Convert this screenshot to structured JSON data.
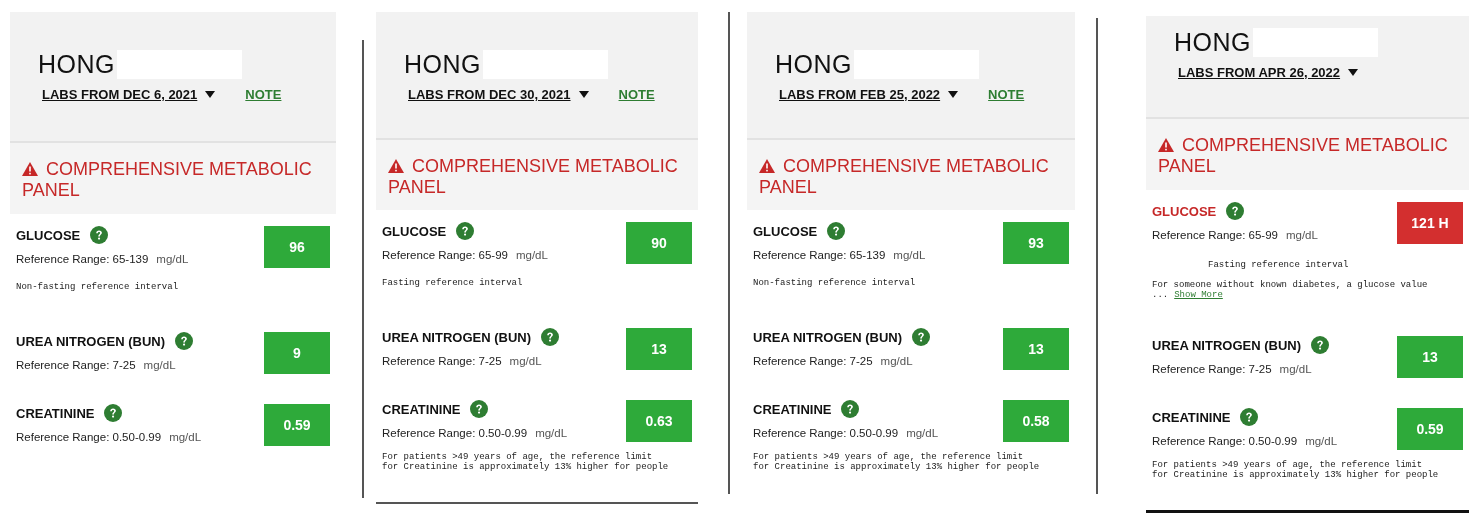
{
  "panels": [
    {
      "patient": "HONG",
      "labs_date": "LABS FROM DEC 6, 2021",
      "note": "NOTE",
      "section": {
        "title": "COMPREHENSIVE METABOLIC PANEL",
        "alert": true
      },
      "tests": [
        {
          "name": "GLUCOSE",
          "range": "Reference Range: 65-139",
          "unit": "mg/dL",
          "value": "96",
          "high": false,
          "interval": "Non-fasting reference interval"
        },
        {
          "name": "UREA NITROGEN (BUN)",
          "range": "Reference Range: 7-25",
          "unit": "mg/dL",
          "value": "9",
          "high": false
        },
        {
          "name": "CREATININE",
          "range": "Reference Range: 0.50-0.99",
          "unit": "mg/dL",
          "value": "0.59",
          "high": false
        }
      ]
    },
    {
      "patient": "HONG",
      "labs_date": "LABS FROM DEC 30, 2021",
      "note": "NOTE",
      "section": {
        "title": "COMPREHENSIVE METABOLIC PANEL",
        "alert": true
      },
      "tests": [
        {
          "name": "GLUCOSE",
          "range": "Reference Range: 65-99",
          "unit": "mg/dL",
          "value": "90",
          "high": false,
          "interval": "Fasting reference interval"
        },
        {
          "name": "UREA NITROGEN (BUN)",
          "range": "Reference Range: 7-25",
          "unit": "mg/dL",
          "value": "13",
          "high": false
        },
        {
          "name": "CREATININE",
          "range": "Reference Range: 0.50-0.99",
          "unit": "mg/dL",
          "value": "0.63",
          "high": false,
          "detail": "For patients >49 years of age, the reference limit\nfor Creatinine is approximately 13% higher for people"
        }
      ]
    },
    {
      "patient": "HONG",
      "labs_date": "LABS FROM FEB 25, 2022",
      "note": "NOTE",
      "section": {
        "title": "COMPREHENSIVE METABOLIC PANEL",
        "alert": true
      },
      "tests": [
        {
          "name": "GLUCOSE",
          "range": "Reference Range: 65-139",
          "unit": "mg/dL",
          "value": "93",
          "high": false,
          "interval": "Non-fasting reference interval"
        },
        {
          "name": "UREA NITROGEN (BUN)",
          "range": "Reference Range: 7-25",
          "unit": "mg/dL",
          "value": "13",
          "high": false
        },
        {
          "name": "CREATININE",
          "range": "Reference Range: 0.50-0.99",
          "unit": "mg/dL",
          "value": "0.58",
          "high": false,
          "detail": "For patients >49 years of age, the reference limit\nfor Creatinine is approximately 13% higher for people"
        }
      ]
    },
    {
      "patient": "HONG",
      "labs_date": "LABS FROM APR 26, 2022",
      "section": {
        "title": "COMPREHENSIVE METABOLIC PANEL",
        "alert": true
      },
      "tests": [
        {
          "name": "GLUCOSE",
          "range": "Reference Range: 65-99",
          "unit": "mg/dL",
          "value": "121 H",
          "high": true,
          "interval": "Fasting reference interval",
          "detail": "For someone without known diabetes, a glucose value",
          "ellipsis": "...",
          "link": "Show More"
        },
        {
          "name": "UREA NITROGEN (BUN)",
          "range": "Reference Range: 7-25",
          "unit": "mg/dL",
          "value": "13",
          "high": false
        },
        {
          "name": "CREATININE",
          "range": "Reference Range: 0.50-0.99",
          "unit": "mg/dL",
          "value": "0.59",
          "high": false,
          "detail": "For patients >49 years of age, the reference limit\nfor Creatinine is approximately 13% higher for people"
        }
      ]
    }
  ]
}
